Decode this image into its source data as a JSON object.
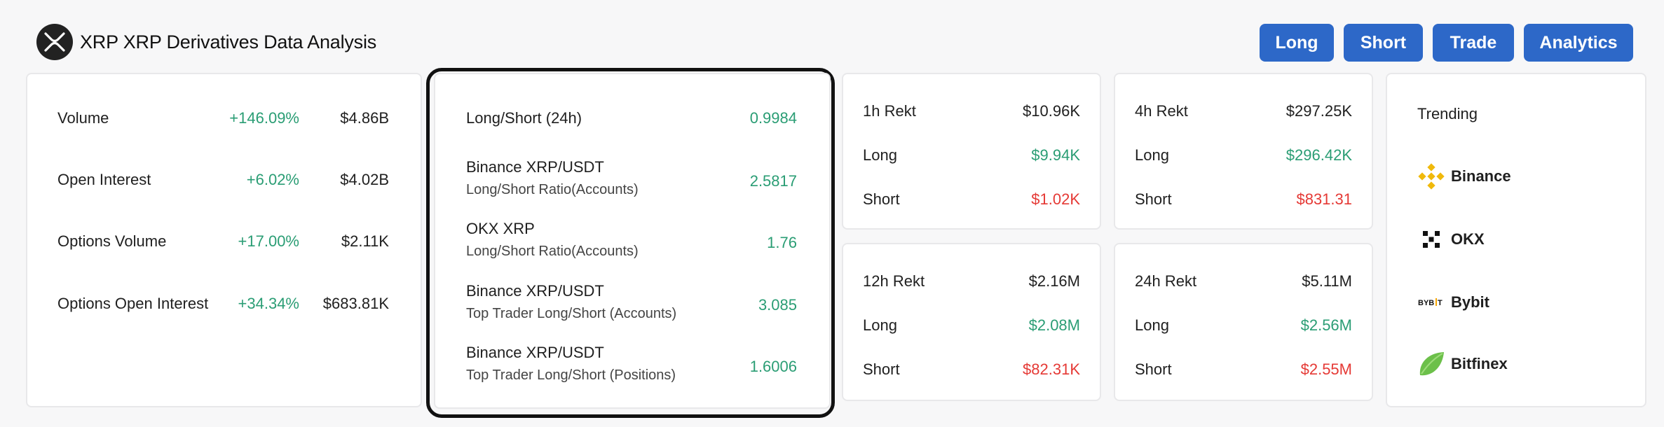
{
  "header": {
    "title": "XRP XRP Derivatives Data Analysis",
    "logo_icon": "xrp-logo-icon"
  },
  "nav": [
    {
      "label": "Long"
    },
    {
      "label": "Short"
    },
    {
      "label": "Trade"
    },
    {
      "label": "Analytics"
    }
  ],
  "market": [
    {
      "label": "Volume",
      "change": "+146.09%",
      "value": "$4.86B"
    },
    {
      "label": "Open Interest",
      "change": "+6.02%",
      "value": "$4.02B"
    },
    {
      "label": "Options Volume",
      "change": "+17.00%",
      "value": "$2.11K"
    },
    {
      "label": "Options Open Interest",
      "change": "+34.34%",
      "value": "$683.81K"
    }
  ],
  "long_short": [
    {
      "label": "Long/Short (24h)",
      "sub": "",
      "value": "0.9984"
    },
    {
      "label": "Binance XRP/USDT",
      "sub": "Long/Short Ratio(Accounts)",
      "value": "2.5817"
    },
    {
      "label": "OKX XRP",
      "sub": "Long/Short Ratio(Accounts)",
      "value": "1.76"
    },
    {
      "label": "Binance XRP/USDT",
      "sub": "Top Trader Long/Short (Accounts)",
      "value": "3.085"
    },
    {
      "label": "Binance XRP/USDT",
      "sub": "Top Trader Long/Short (Positions)",
      "value": "1.6006"
    }
  ],
  "rekt": [
    {
      "period": "1h Rekt",
      "total": "$10.96K",
      "long_label": "Long",
      "long": "$9.94K",
      "short_label": "Short",
      "short": "$1.02K"
    },
    {
      "period": "4h Rekt",
      "total": "$297.25K",
      "long_label": "Long",
      "long": "$296.42K",
      "short_label": "Short",
      "short": "$831.31"
    },
    {
      "period": "12h Rekt",
      "total": "$2.16M",
      "long_label": "Long",
      "long": "$2.08M",
      "short_label": "Short",
      "short": "$82.31K"
    },
    {
      "period": "24h Rekt",
      "total": "$5.11M",
      "long_label": "Long",
      "long": "$2.56M",
      "short_label": "Short",
      "short": "$2.55M"
    }
  ],
  "trending": {
    "title": "Trending",
    "exchanges": [
      {
        "name": "Binance",
        "icon": "binance-icon",
        "color": "#f0b90b"
      },
      {
        "name": "OKX",
        "icon": "okx-icon",
        "color": "#111111"
      },
      {
        "name": "Bybit",
        "icon": "bybit-icon",
        "color": "#111111"
      },
      {
        "name": "Bitfinex",
        "icon": "bitfinex-icon",
        "color": "#6cc04a"
      }
    ]
  },
  "colors": {
    "accent": "#2d68c8",
    "positive": "#2a9d74",
    "negative": "#e53935"
  }
}
